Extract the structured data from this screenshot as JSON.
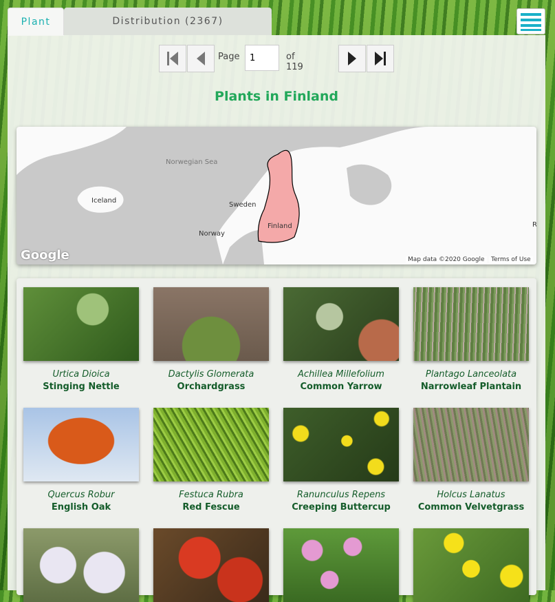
{
  "tabs": {
    "plant": "Plant",
    "distribution": "Distribution (2367)"
  },
  "pager": {
    "page_label": "Page",
    "page_value": "1",
    "of_label": "of 119"
  },
  "title": "Plants in Finland",
  "map": {
    "labels": {
      "norwegian_sea": "Norwegian Sea",
      "iceland": "Iceland",
      "sweden": "Sweden",
      "norway": "Norway",
      "finland": "Finland",
      "edge": "R"
    },
    "logo": "Google",
    "map_data": "Map data ©2020 Google",
    "terms": "Terms of Use",
    "highlight_color": "#f4a9a9"
  },
  "plants": [
    {
      "latin": "Urtica Dioica",
      "common": "Stinging Nettle"
    },
    {
      "latin": "Dactylis Glomerata",
      "common": "Orchardgrass"
    },
    {
      "latin": "Achillea Millefolium",
      "common": "Common Yarrow"
    },
    {
      "latin": "Plantago Lanceolata",
      "common": "Narrowleaf Plantain"
    },
    {
      "latin": "Quercus Robur",
      "common": "English Oak"
    },
    {
      "latin": "Festuca Rubra",
      "common": "Red Fescue"
    },
    {
      "latin": "Ranunculus Repens",
      "common": "Creeping Buttercup"
    },
    {
      "latin": "Holcus Lanatus",
      "common": "Common Velvetgrass"
    }
  ]
}
